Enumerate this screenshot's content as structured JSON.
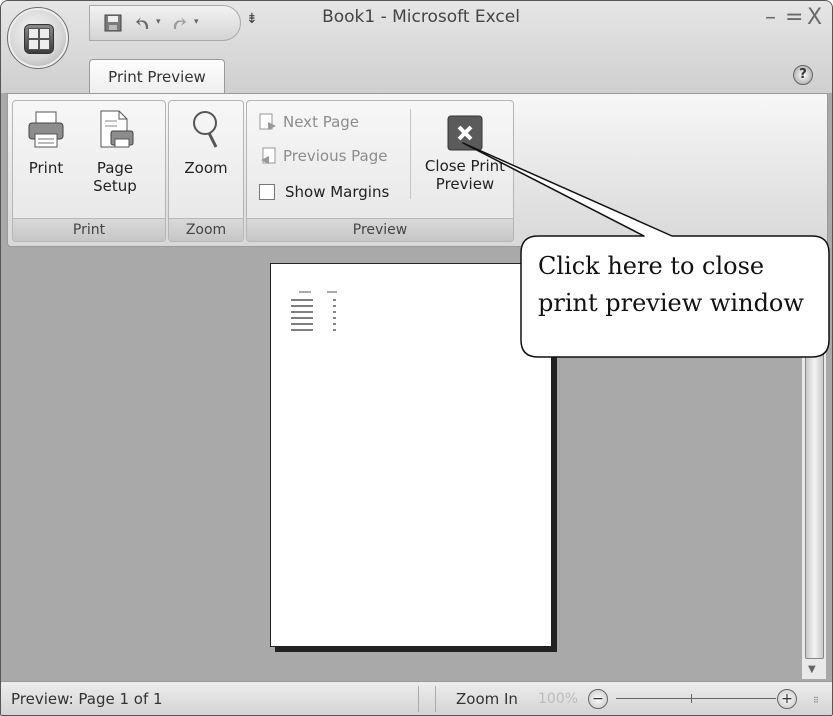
{
  "window": {
    "title": "Book1 - Microsoft Excel",
    "controls": {
      "minimize": "–",
      "maximize": "=",
      "close": "X"
    },
    "help_label": "?"
  },
  "quick_access": {
    "icons": [
      "save-icon",
      "undo-icon",
      "redo-icon",
      "customize-arrow-icon"
    ],
    "customize_glyph": "⇟"
  },
  "ribbon": {
    "active_tab": "Print Preview",
    "groups": {
      "print": {
        "label": "Print",
        "buttons": {
          "print": "Print",
          "page_setup_line1": "Page",
          "page_setup_line2": "Setup"
        }
      },
      "zoom": {
        "label": "Zoom",
        "buttons": {
          "zoom": "Zoom"
        }
      },
      "preview": {
        "label": "Preview",
        "buttons": {
          "next_page": "Next Page",
          "previous_page": "Previous Page",
          "show_margins": "Show Margins",
          "close_line1": "Close Print",
          "close_line2": "Preview"
        }
      }
    }
  },
  "callout": {
    "line1": "Click here to close",
    "line2": "print preview window"
  },
  "statusbar": {
    "status": "Preview: Page 1 of 1",
    "zoom_in": "Zoom In",
    "zoom_percent": "100%",
    "zoom_out_glyph": "−",
    "zoom_in_glyph": "+"
  },
  "colors": {
    "workarea": "#a9a9a9",
    "ribbon_light": "#f7f7f7",
    "close_button": "#5b5b5b"
  }
}
